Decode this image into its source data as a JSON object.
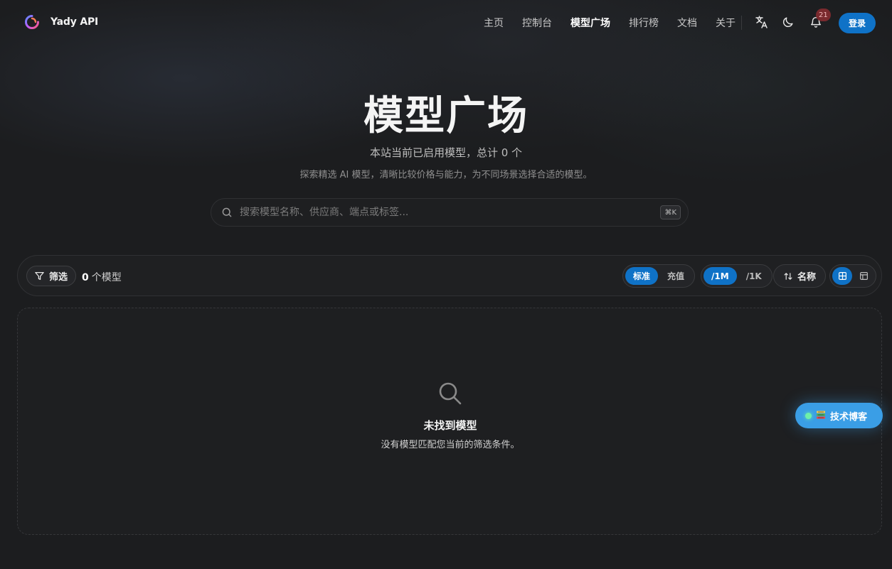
{
  "brand": {
    "name": "Yady API"
  },
  "nav": {
    "items": [
      {
        "label": "主页"
      },
      {
        "label": "控制台"
      },
      {
        "label": "模型广场"
      },
      {
        "label": "排行榜"
      },
      {
        "label": "文档"
      },
      {
        "label": "关于"
      }
    ],
    "active_index": 2
  },
  "header": {
    "notification_count": "21",
    "login_label": "登录",
    "icons": [
      "translate-icon",
      "moon-icon",
      "bell-icon"
    ]
  },
  "hero": {
    "title": "模型广场",
    "subtitle": "本站当前已启用模型，总计 0 个",
    "description": "探索精选 AI 模型，清晰比较价格与能力，为不同场景选择合适的模型。"
  },
  "search": {
    "placeholder": "搜索模型名称、供应商、端点或标签...",
    "value": "",
    "shortcut": "⌘K"
  },
  "toolbar": {
    "filter_label": "筛选",
    "model_count": "0",
    "model_count_suffix": "个模型",
    "price_modes": [
      "标准",
      "充值"
    ],
    "price_mode_selected": "标准",
    "units": [
      "/1M",
      "/1K"
    ],
    "unit_selected": "/1M",
    "sort_label": "名称",
    "view_modes": [
      "grid",
      "table"
    ],
    "view_selected": "grid"
  },
  "empty_state": {
    "title": "未找到模型",
    "description": "没有模型匹配您当前的筛选条件。"
  },
  "floating": {
    "blog_label": "技术博客"
  },
  "colors": {
    "accent": "#0f72c7",
    "background": "#1c1d1f",
    "badge": "#7a2a2e",
    "blog_button": "#3a9ee6"
  }
}
